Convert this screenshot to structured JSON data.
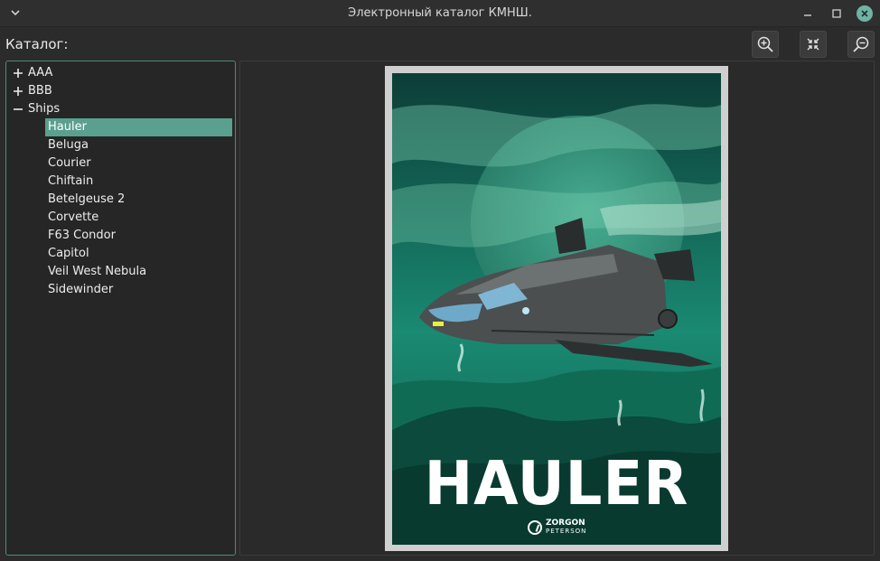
{
  "window": {
    "title": "Электронный каталог КМНШ."
  },
  "toolbar": {
    "label": "Каталог:",
    "buttons": {
      "zoom_in": "zoom-in-icon",
      "fit": "fit-to-window-icon",
      "zoom_out": "zoom-out-icon"
    }
  },
  "tree": {
    "groups": [
      {
        "label": "AAA",
        "expanded": false
      },
      {
        "label": "BBB",
        "expanded": false
      },
      {
        "label": "Ships",
        "expanded": true
      }
    ],
    "ships": [
      {
        "label": "Hauler",
        "selected": true
      },
      {
        "label": "Beluga"
      },
      {
        "label": "Courier"
      },
      {
        "label": "Chiftain"
      },
      {
        "label": "Betelgeuse 2"
      },
      {
        "label": "Corvette"
      },
      {
        "label": "F63 Condor"
      },
      {
        "label": "Capitol"
      },
      {
        "label": "Veil West Nebula"
      },
      {
        "label": "Sidewinder"
      }
    ]
  },
  "viewer": {
    "poster_title": "HAULER",
    "logo_brand": "ZORGON",
    "logo_sub": "PETERSON"
  },
  "colors": {
    "accent": "#5aa08f",
    "close_button": "#6fb3a5",
    "panel_border": "#4d8a7c"
  }
}
